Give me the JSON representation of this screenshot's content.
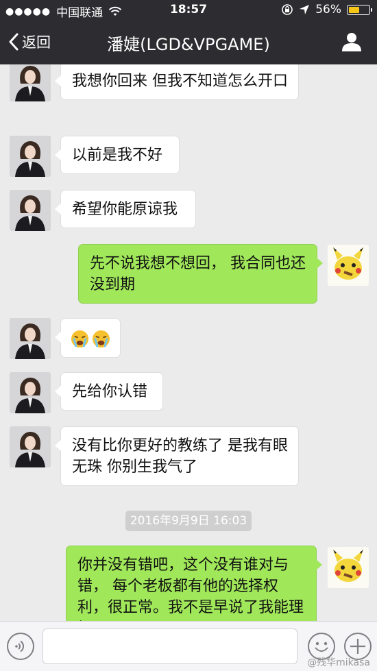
{
  "status_bar": {
    "carrier": "中国联通",
    "time": "18:57",
    "battery_percent": "56%",
    "battery_level": 0.56
  },
  "nav": {
    "back_label": "返回",
    "title": "潘婕(LGD&VPGAME)"
  },
  "messages": [
    {
      "side": "in",
      "text": "我想你回来 但我不知道怎么开口"
    },
    {
      "side": "in",
      "text": "以前是我不好"
    },
    {
      "side": "in",
      "text": "希望你能原谅我"
    },
    {
      "side": "out",
      "text": "先不说我想不想回， 我合同也还没到期"
    },
    {
      "side": "in",
      "emoji": [
        "crying-face",
        "crying-face"
      ]
    },
    {
      "side": "in",
      "text": "先给你认错"
    },
    {
      "side": "in",
      "text": "没有比你更好的教练了 是我有眼无珠 你别生我气了"
    },
    {
      "side": "out",
      "text": "你并没有错吧，这个没有谁对与错， 每个老板都有他的选择权利，很正常。我不是早说了我能理解"
    }
  ],
  "timestamp": "2016年9月9日 16:03",
  "watermark": "@残华mikasa",
  "colors": {
    "header_bg": "#2d2d31",
    "chat_bg": "#ebebeb",
    "outgoing_bubble": "#a0e75a",
    "incoming_bubble": "#ffffff"
  },
  "icons": {
    "back": "chevron-left-icon",
    "profile": "person-icon",
    "voice": "voice-icon",
    "emoji": "smiley-icon",
    "more": "plus-icon"
  }
}
